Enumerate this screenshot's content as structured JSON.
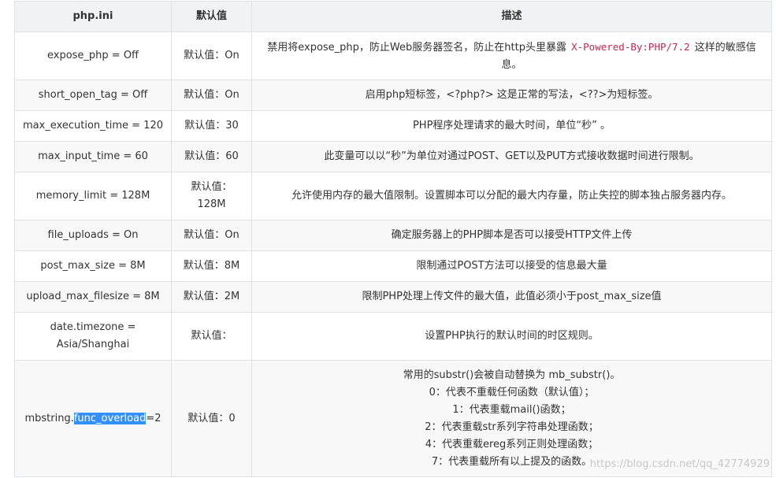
{
  "table": {
    "headers": {
      "key": "php.ini",
      "default": "默认值",
      "desc": "描述"
    },
    "rows": [
      {
        "key": "expose_php = Off",
        "default": "默认值：On",
        "desc_before": "禁用将expose_php，防止Web服务器签名，防止在http头里暴露",
        "desc_code": "X-Powered-By:PHP/7.2",
        "desc_after": "这样的敏感信息。"
      },
      {
        "key": "short_open_tag = Off",
        "default": "默认值：On",
        "desc": "启用php短标签，<?php?> 这是正常的写法，<??>为短标签。"
      },
      {
        "key": "max_execution_time = 120",
        "default": "默认值：30",
        "desc": "PHP程序处理请求的最大时间，单位“秒” 。"
      },
      {
        "key": "max_input_time = 60",
        "default": "默认值：60",
        "desc": "此变量可以以“秒”为单位对通过POST、GET以及PUT方式接收数据时间进行限制。"
      },
      {
        "key": "memory_limit = 128M",
        "default_line1": "默认值：",
        "default_line2": "128M",
        "desc": "允许使用内存的最大值限制。设置脚本可以分配的最大内存量，防止失控的脚本独占服务器内存。"
      },
      {
        "key": "file_uploads = On",
        "default": "默认值：On",
        "desc": "确定服务器上的PHP脚本是否可以接受HTTP文件上传"
      },
      {
        "key": "post_max_size = 8M",
        "default": "默认值：8M",
        "desc": "限制通过POST方法可以接受的信息最大量"
      },
      {
        "key": "upload_max_filesize = 8M",
        "default": "默认值：2M",
        "desc": "限制PHP处理上传文件的最大值，此值必须小于post_max_size值"
      },
      {
        "key_line1": "date.timezone =",
        "key_line2": "Asia/Shanghai",
        "default": "默认值：",
        "desc": "设置PHP执行的默认时间的时区规则。"
      },
      {
        "key_prefix": "mbstring.",
        "key_highlight": "func_overload",
        "key_suffix": "=2",
        "default": "默认值：0",
        "desc_lines": [
          "常用的substr()会被自动替换为 mb_substr()。",
          "0：代表不重载任何函数（默认值）；",
          "1：代表重载mail()函数；",
          "2：代表重载str系列字符串处理函数；",
          "4：代表重载ereg系列正则处理函数；",
          "7：代表重载所有以上提及的函数。"
        ]
      }
    ]
  },
  "watermark": "https://blog.csdn.net/qq_42774929",
  "colors": {
    "header_bg": "#eff3f5",
    "row_alt_bg": "#f8f8f8",
    "border": "#dfe2e5",
    "code": "#c7254e",
    "selection": "#3390ff"
  }
}
